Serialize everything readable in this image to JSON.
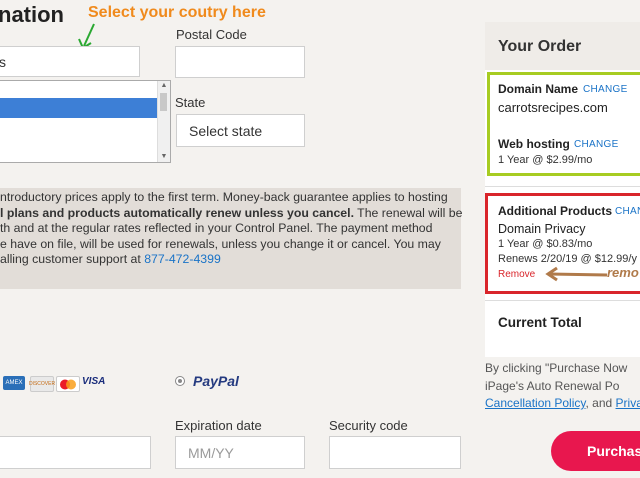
{
  "heading": "nation",
  "annotation": "Select your coutry here",
  "country": {
    "value": "s"
  },
  "postal": {
    "label": "Postal Code"
  },
  "state": {
    "label": "State",
    "select_value": "Select state"
  },
  "notice": {
    "line1": "ntroductory prices apply to the first term. Money-back guarantee applies to hosting",
    "line2_bold": "l plans and products automatically renew unless you cancel.",
    "line2_rest": " The renewal will be",
    "line3": "th and at the regular rates reflected in your Control Panel. The payment method",
    "line4": "e have on file, will be used for renewals, unless you change it or cancel. You may",
    "line5_pre": "alling customer support at ",
    "phone": "877-472-4399"
  },
  "payment": {
    "cards": [
      "AMEX",
      "DISCOVER",
      "MC",
      "VISA"
    ],
    "paypal_label": "PayPal",
    "expiration_label": "Expiration date",
    "expiration_placeholder": "MM/YY",
    "security_label": "Security code"
  },
  "order": {
    "title": "Your Order",
    "domain_label": "Domain Name",
    "change": "CHANGE",
    "domain_value": "carrotsrecipes.com",
    "hosting_label": "Web hosting",
    "hosting_price": "1 Year @ $2.99/mo",
    "additional_label": "Additional Products",
    "additional_change": "CHAN",
    "privacy": "Domain Privacy",
    "privacy_price": "1 Year @ $0.83/mo",
    "renews": "Renews 2/20/19 @ $12.99/y",
    "remove": "Remove",
    "remove_annot": "remo",
    "current_total": "Current Total",
    "fine1": "By  clicking  \"Purchase  Now",
    "fine2": "iPage's  Auto  Renewal  Po",
    "fine3_link1": "Cancellation Policy",
    "fine3_mid": ", and ",
    "fine3_link2": "Priva",
    "purchase": "Purchase"
  },
  "colors": {
    "accent": "#e8174e",
    "link": "#1a73c7",
    "annotation": "#f08a1c",
    "green_box": "#a7cc22",
    "red_box": "#d9252b"
  }
}
